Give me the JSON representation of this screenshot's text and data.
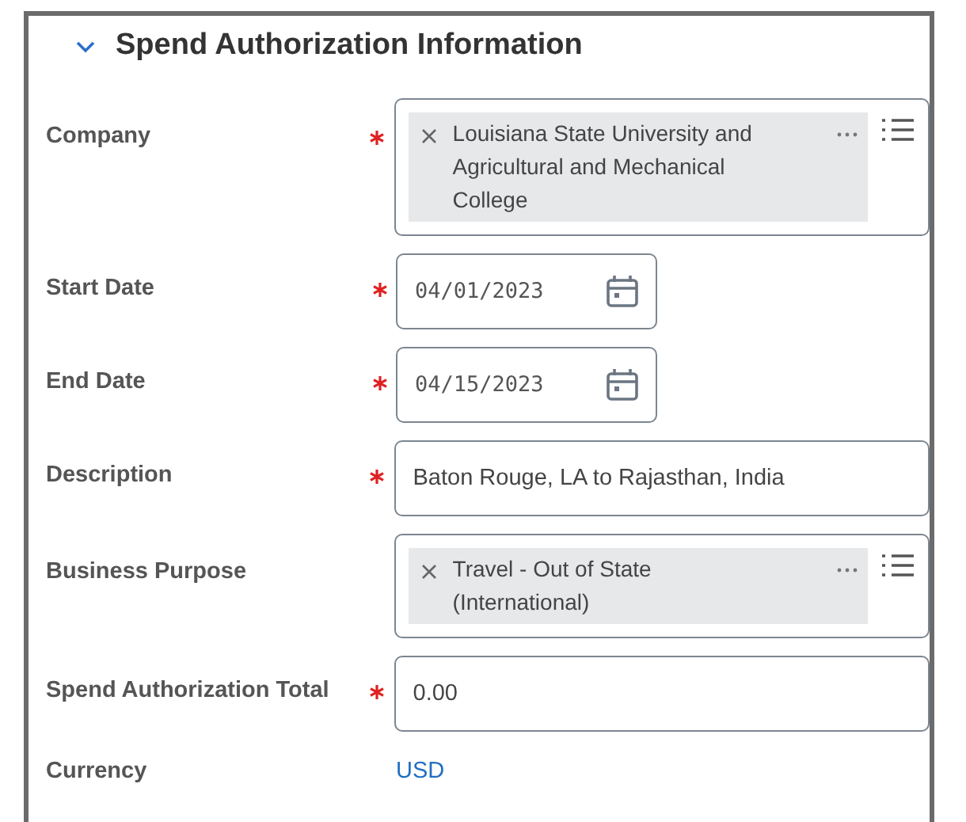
{
  "section": {
    "title": "Spend Authorization Information",
    "expanded": true
  },
  "fields": [
    {
      "label": "Company",
      "required": true,
      "kind": "multiselect",
      "items": [
        "Louisiana State University and Agricultural and Mechanical College"
      ]
    },
    {
      "label": "Start Date",
      "required": true,
      "kind": "date",
      "value": "04/01/2023"
    },
    {
      "label": "End Date",
      "required": true,
      "kind": "date",
      "value": "04/15/2023"
    },
    {
      "label": "Description",
      "required": true,
      "kind": "text",
      "value": "Baton Rouge, LA to Rajasthan, India"
    },
    {
      "label": "Business Purpose",
      "required": false,
      "kind": "multiselect",
      "items": [
        "Travel - Out of State (International)"
      ]
    },
    {
      "label": "Spend Authorization Total",
      "required": true,
      "kind": "text",
      "value": "0.00"
    },
    {
      "label": "Currency",
      "required": false,
      "kind": "link",
      "value": "USD"
    }
  ]
}
